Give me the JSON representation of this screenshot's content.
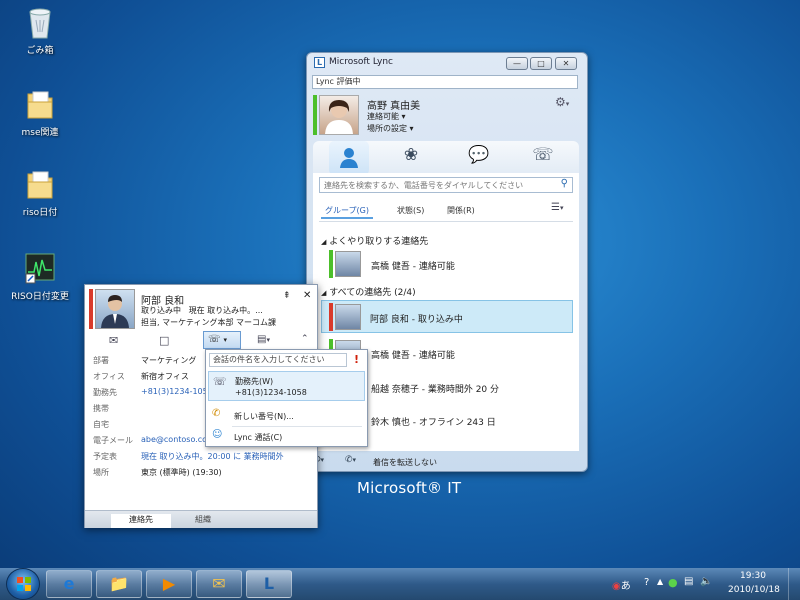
{
  "desktop": {
    "icons": [
      {
        "label": "ごみ箱",
        "icon": "recycle-bin-icon"
      },
      {
        "label": "mse関連",
        "icon": "folder-icon"
      },
      {
        "label": "riso日付",
        "icon": "folder-icon"
      },
      {
        "label": "RISO日付変更",
        "icon": "shortcut-icon"
      }
    ],
    "brand": "Microsoft® IT"
  },
  "lync": {
    "title": "Microsoft Lync",
    "note": "Lync 評価中",
    "user": {
      "name": "高野 真由美",
      "status": "連絡可能",
      "location": "場所の設定"
    },
    "search_placeholder": "連絡先を検索するか、電話番号をダイヤルしてください",
    "view_tabs": [
      "グループ(G)",
      "状態(S)",
      "関係(R)"
    ],
    "groups": [
      {
        "name": "よくやり取りする連絡先",
        "items": [
          {
            "text": "高橋 健吾 - 連絡可能",
            "status": "available"
          }
        ]
      },
      {
        "name": "すべての連絡先 (2/4)",
        "items": [
          {
            "text": "阿部 良和 - 取り込み中",
            "status": "busy"
          },
          {
            "text": "高橋 健吾 - 連絡可能",
            "status": "available"
          },
          {
            "text": "船越 奈穂子 - 業務時間外 20 分",
            "status": "away"
          },
          {
            "text": "鈴木 慎也 - オフライン 243 日",
            "status": "offline"
          }
        ]
      }
    ],
    "forward_label": "着信を転送しない"
  },
  "card": {
    "name": "阿部 良和",
    "status_line": "取り込み中   現在 取り込み中。...",
    "title_line": "担当, マーケティング本部 マーコム課",
    "fields": [
      {
        "label": "部署",
        "value": "マーケティング"
      },
      {
        "label": "オフィス",
        "value": "新宿オフィス"
      },
      {
        "label": "勤務先",
        "value": "+81(3)1234-105"
      },
      {
        "label": "携帯",
        "value": ""
      },
      {
        "label": "自宅",
        "value": ""
      },
      {
        "label": "電子メール",
        "value": "abe@contoso.co"
      },
      {
        "label": "予定表",
        "value": "現在 取り込み中。20:00 に 業務時間外"
      },
      {
        "label": "場所",
        "value": "東京 (標準時) (19:30)"
      }
    ],
    "tabs": [
      "連絡先",
      "組織"
    ]
  },
  "menu": {
    "subject_placeholder": "会話の件名を入力してください",
    "items": [
      {
        "label": "勤務先(W)",
        "sub": "+81(3)1234-1058"
      },
      {
        "label": "新しい番号(N)...",
        "sub": ""
      },
      {
        "label": "Lync 通話(C)",
        "sub": ""
      }
    ]
  },
  "taskbar": {
    "time": "19:30",
    "date": "2010/10/18",
    "ime": "あ"
  }
}
